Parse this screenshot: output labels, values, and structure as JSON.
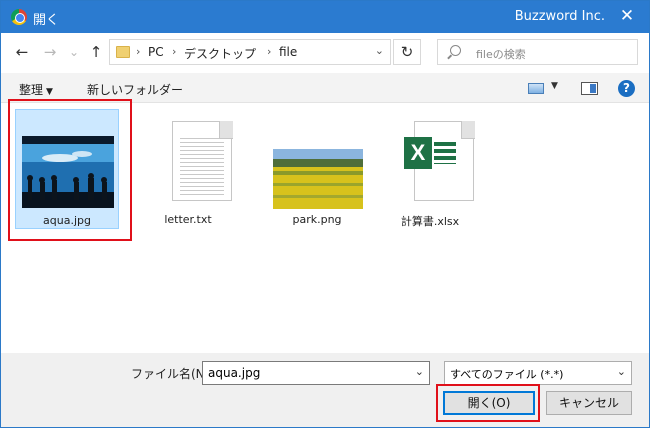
{
  "window": {
    "title": "開く",
    "brand": "Buzzword Inc.",
    "close_glyph": "✕"
  },
  "nav": {
    "back_glyph": "←",
    "forward_glyph": "→",
    "recent_glyph": "⌄",
    "up_glyph": "↑",
    "breadcrumb": [
      "PC",
      "デスクトップ",
      "file"
    ],
    "separator": "›",
    "dropdown_glyph": "⌄",
    "refresh_glyph": "↻",
    "search_placeholder": "fileの検索"
  },
  "toolbar": {
    "organize_label": "整理",
    "new_folder_label": "新しいフォルダー",
    "caret": "▼",
    "help_glyph": "?"
  },
  "files": [
    {
      "name": "aqua.jpg",
      "selected": true
    },
    {
      "name": "letter.txt",
      "selected": false
    },
    {
      "name": "park.png",
      "selected": false
    },
    {
      "name": "計算書.xlsx",
      "selected": false
    }
  ],
  "excel_badge": "X",
  "footer": {
    "filename_label": "ファイル名(N):",
    "filename_value": "aqua.jpg",
    "filter_value": "すべてのファイル (*.*)",
    "dropdown_glyph": "⌄",
    "open_button": "開く(O)",
    "cancel_button": "キャンセル"
  },
  "colors": {
    "titlebar": "#2b7bd0",
    "selection": "#cce8ff",
    "highlight": "#e0101a",
    "primary_border": "#0078d7"
  }
}
